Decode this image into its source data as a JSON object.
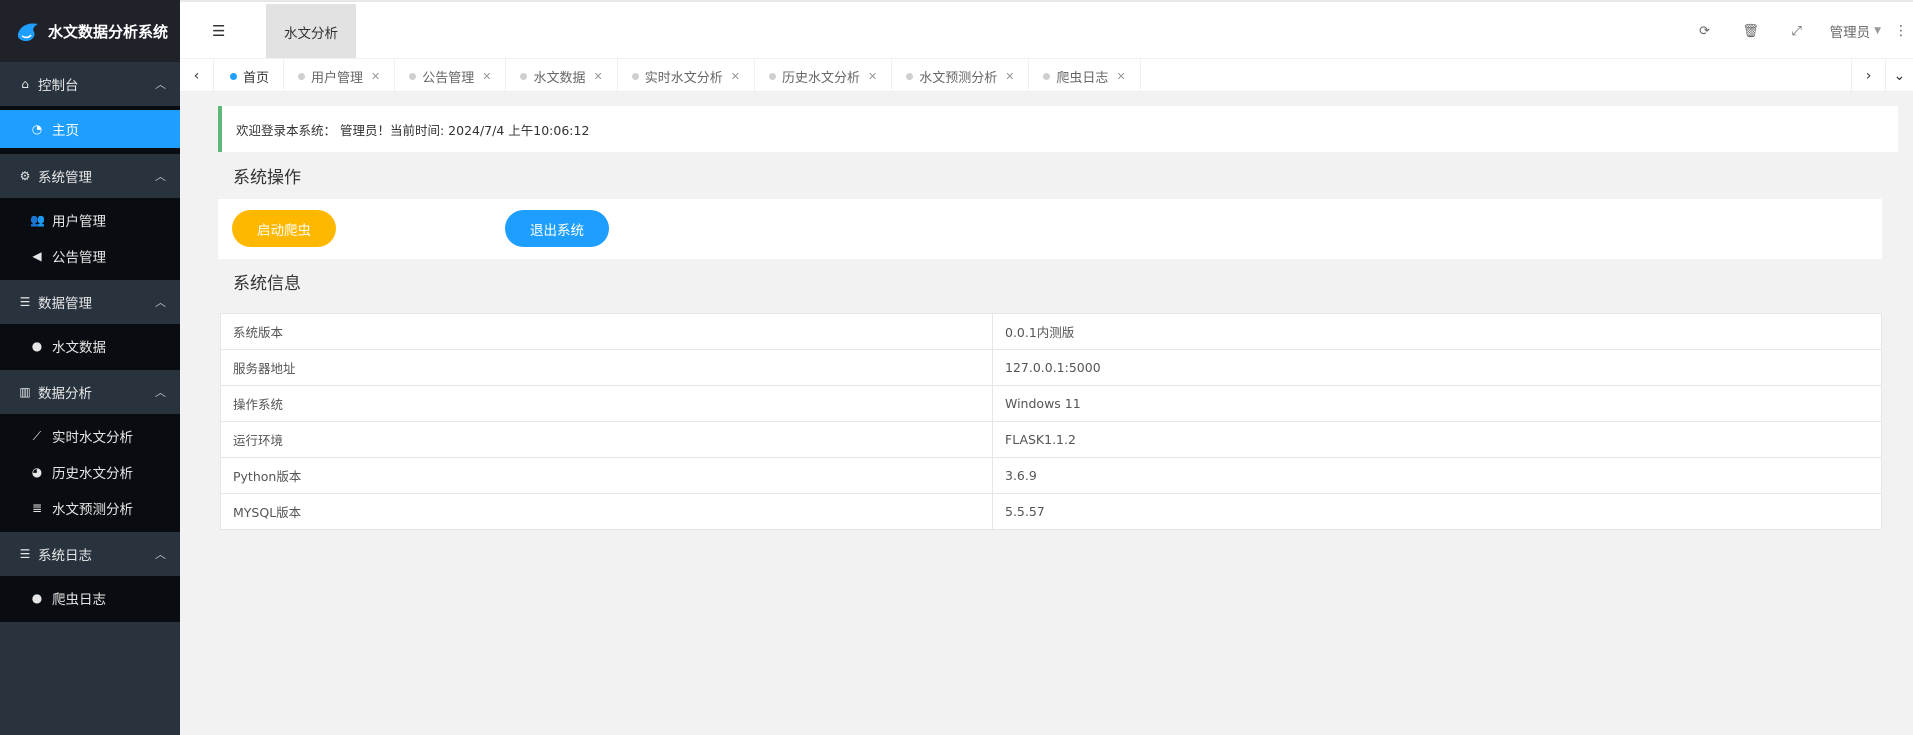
{
  "app": {
    "title": "水文数据分析系统"
  },
  "sidebar": {
    "groups": [
      {
        "label": "控制台",
        "icon": "home-icon",
        "items": [
          {
            "label": "主页",
            "icon": "dashboard-icon",
            "active": true
          }
        ]
      },
      {
        "label": "系统管理",
        "icon": "gears-icon",
        "items": [
          {
            "label": "用户管理",
            "icon": "users-icon"
          },
          {
            "label": "公告管理",
            "icon": "volume-icon"
          }
        ]
      },
      {
        "label": "数据管理",
        "icon": "list-icon",
        "items": [
          {
            "label": "水文数据",
            "icon": "globe-icon"
          }
        ]
      },
      {
        "label": "数据分析",
        "icon": "bar-chart-icon",
        "items": [
          {
            "label": "实时水文分析",
            "icon": "line-chart-icon"
          },
          {
            "label": "历史水文分析",
            "icon": "pie-chart-icon"
          },
          {
            "label": "水文预测分析",
            "icon": "database-icon"
          }
        ]
      },
      {
        "label": "系统日志",
        "icon": "list-icon",
        "items": [
          {
            "label": "爬虫日志",
            "icon": "globe-icon"
          }
        ]
      }
    ]
  },
  "header": {
    "top_tab": "水文分析",
    "user": "管理员"
  },
  "tabs": [
    {
      "label": "首页",
      "active": true,
      "closable": false
    },
    {
      "label": "用户管理",
      "active": false,
      "closable": true
    },
    {
      "label": "公告管理",
      "active": false,
      "closable": true
    },
    {
      "label": "水文数据",
      "active": false,
      "closable": true
    },
    {
      "label": "实时水文分析",
      "active": false,
      "closable": true
    },
    {
      "label": "历史水文分析",
      "active": false,
      "closable": true
    },
    {
      "label": "水文预测分析",
      "active": false,
      "closable": true
    },
    {
      "label": "爬虫日志",
      "active": false,
      "closable": true
    }
  ],
  "welcome": "欢迎登录本系统： 管理员！当前时间: 2024/7/4 上午10:06:12",
  "operations": {
    "title": "系统操作",
    "start_crawler": "启动爬虫",
    "exit_system": "退出系统"
  },
  "system_info": {
    "title": "系统信息",
    "rows": [
      {
        "key": "系统版本",
        "value": "0.0.1内测版"
      },
      {
        "key": "服务器地址",
        "value": "127.0.0.1:5000"
      },
      {
        "key": "操作系统",
        "value": "Windows 11"
      },
      {
        "key": "运行环境",
        "value": "FLASK1.1.2"
      },
      {
        "key": "Python版本",
        "value": "3.6.9"
      },
      {
        "key": "MYSQL版本",
        "value": "5.5.57"
      }
    ]
  },
  "colors": {
    "sidebar_bg": "#28333e",
    "sidebar_sub_bg": "#090d12",
    "active_blue": "#1e9fff",
    "warn_orange": "#ffb800",
    "success_green": "#5fb878"
  }
}
